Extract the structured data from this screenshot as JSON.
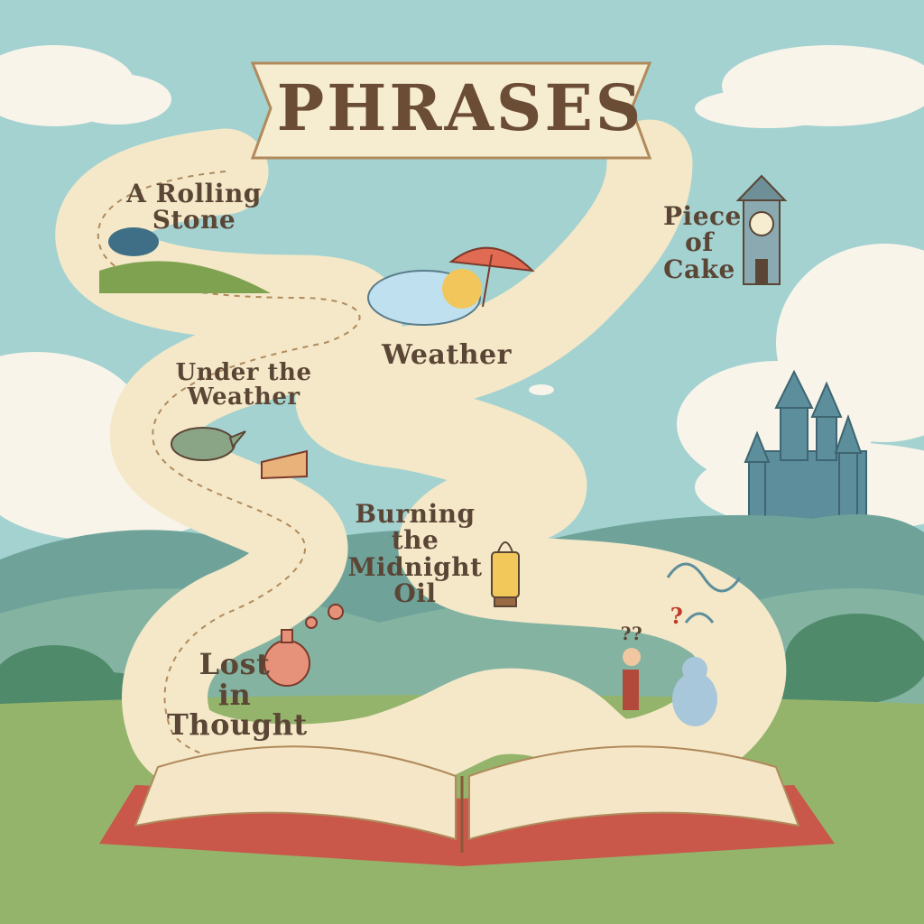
{
  "title": "PHRASES",
  "phrases": {
    "rolling_stone": "A Rolling\nStone",
    "piece_of_cake": "Piece\nof\nCake",
    "weather": "Weather",
    "under_the_weather": "Under the\nWeather",
    "midnight_oil": "Burning\nthe Midnight\nOil",
    "lost_in_thought": "Lost\nin\nThought"
  },
  "question_marks": [
    "??",
    "?"
  ],
  "colors": {
    "sky": "#9fcfcf",
    "scroll": "#f6ecd0",
    "scroll_edge": "#b08a5c",
    "ink": "#5b4636",
    "hills": "#7fb0a6",
    "grass": "#8fb06a",
    "book_cover": "#c9574a",
    "castle": "#5d8e9c"
  }
}
